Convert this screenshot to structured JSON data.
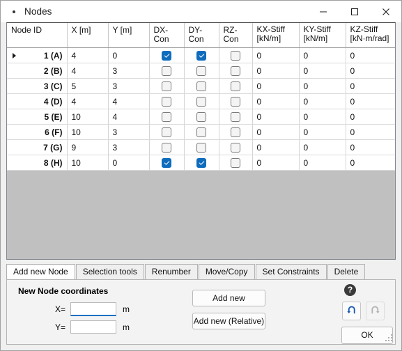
{
  "window": {
    "title": "Nodes",
    "icon": "app-dot-icon",
    "controls": {
      "minimize": "minimize-icon",
      "maximize": "maximize-icon",
      "close": "close-icon"
    }
  },
  "table": {
    "columns": [
      {
        "key": "node_id",
        "label": "Node ID",
        "sub": ""
      },
      {
        "key": "x",
        "label": "X [m]",
        "sub": ""
      },
      {
        "key": "y",
        "label": "Y [m]",
        "sub": ""
      },
      {
        "key": "dx_con",
        "label": "DX-Con",
        "sub": ""
      },
      {
        "key": "dy_con",
        "label": "DY-Con",
        "sub": ""
      },
      {
        "key": "rz_con",
        "label": "RZ-Con",
        "sub": ""
      },
      {
        "key": "kx_stiff",
        "label": "KX-Stiff",
        "sub": "[kN/m]"
      },
      {
        "key": "ky_stiff",
        "label": "KY-Stiff",
        "sub": "[kN/m]"
      },
      {
        "key": "kz_stiff",
        "label": "KZ-Stiff",
        "sub": "[kN·m/rad]"
      }
    ],
    "rows": [
      {
        "node_id": "1 (A)",
        "x": "4",
        "y": "0",
        "dx_con": true,
        "dy_con": true,
        "rz_con": false,
        "kx_stiff": "0",
        "ky_stiff": "0",
        "kz_stiff": "0",
        "current": true,
        "x_selected": true
      },
      {
        "node_id": "2 (B)",
        "x": "4",
        "y": "3",
        "dx_con": false,
        "dy_con": false,
        "rz_con": false,
        "kx_stiff": "0",
        "ky_stiff": "0",
        "kz_stiff": "0",
        "current": false,
        "x_selected": false
      },
      {
        "node_id": "3 (C)",
        "x": "5",
        "y": "3",
        "dx_con": false,
        "dy_con": false,
        "rz_con": false,
        "kx_stiff": "0",
        "ky_stiff": "0",
        "kz_stiff": "0",
        "current": false,
        "x_selected": false
      },
      {
        "node_id": "4 (D)",
        "x": "4",
        "y": "4",
        "dx_con": false,
        "dy_con": false,
        "rz_con": false,
        "kx_stiff": "0",
        "ky_stiff": "0",
        "kz_stiff": "0",
        "current": false,
        "x_selected": false
      },
      {
        "node_id": "5 (E)",
        "x": "10",
        "y": "4",
        "dx_con": false,
        "dy_con": false,
        "rz_con": false,
        "kx_stiff": "0",
        "ky_stiff": "0",
        "kz_stiff": "0",
        "current": false,
        "x_selected": false
      },
      {
        "node_id": "6 (F)",
        "x": "10",
        "y": "3",
        "dx_con": false,
        "dy_con": false,
        "rz_con": false,
        "kx_stiff": "0",
        "ky_stiff": "0",
        "kz_stiff": "0",
        "current": false,
        "x_selected": false
      },
      {
        "node_id": "7 (G)",
        "x": "9",
        "y": "3",
        "dx_con": false,
        "dy_con": false,
        "rz_con": false,
        "kx_stiff": "0",
        "ky_stiff": "0",
        "kz_stiff": "0",
        "current": false,
        "x_selected": false
      },
      {
        "node_id": "8 (H)",
        "x": "10",
        "y": "0",
        "dx_con": true,
        "dy_con": true,
        "rz_con": false,
        "kx_stiff": "0",
        "ky_stiff": "0",
        "kz_stiff": "0",
        "current": false,
        "x_selected": false
      }
    ]
  },
  "tabs": [
    {
      "label": "Add new Node",
      "active": true
    },
    {
      "label": "Selection tools",
      "active": false
    },
    {
      "label": "Renumber",
      "active": false
    },
    {
      "label": "Move/Copy",
      "active": false
    },
    {
      "label": "Set Constraints",
      "active": false
    },
    {
      "label": "Delete",
      "active": false
    }
  ],
  "panel": {
    "group_title": "New Node coordinates",
    "fields": [
      {
        "label": "X=",
        "value": "",
        "unit": "m",
        "focused": true
      },
      {
        "label": "Y=",
        "value": "",
        "unit": "m",
        "focused": false
      }
    ],
    "buttons": [
      {
        "label": "Add new"
      },
      {
        "label": "Add new (Relative)"
      }
    ],
    "help_glyph": "?",
    "undo": {
      "icon": "undo-icon",
      "enabled": true
    },
    "redo": {
      "icon": "redo-icon",
      "enabled": false
    },
    "ok_label": "OK"
  },
  "colors": {
    "selection_blue": "#0d7bd4",
    "checkbox_blue": "#0f6cbd",
    "focus_underline": "#0d6fc4",
    "empty_area": "#c0c0c0",
    "undo_enabled": "#1659b5",
    "redo_disabled": "#b4b4b4"
  }
}
